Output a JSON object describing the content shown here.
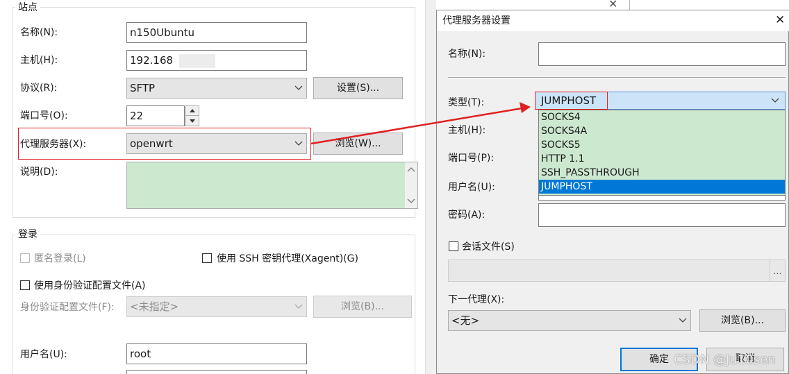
{
  "left_dialog": {
    "site_group_title": "站点",
    "name_label": "名称(N):",
    "name_value": "n150Ubuntu",
    "host_label": "主机(H):",
    "host_value": "192.168",
    "protocol_label": "协议(R):",
    "protocol_value": "SFTP",
    "settings_button": "设置(S)...",
    "port_label": "端口号(O):",
    "port_value": "22",
    "proxy_label": "代理服务器(X):",
    "proxy_value": "openwrt",
    "browse_button": "浏览(W)...",
    "description_label": "说明(D):",
    "login_group_title": "登录",
    "anonymous_login": "匿名登录(L)",
    "ssh_agent": "使用 SSH 密钥代理(Xagent)(G)",
    "use_auth_profile": "使用身份验证配置文件(A)",
    "auth_profile_label": "身份验证配置文件(F):",
    "auth_profile_value": "<未指定>",
    "auth_browse_button": "浏览(B)...",
    "username_label": "用户名(U):",
    "username_value": "root"
  },
  "proxy_dialog": {
    "title": "代理服务器设置",
    "close_glyph": "✕",
    "name_label": "名称(N):",
    "name_value": "",
    "type_label": "类型(T):",
    "type_value": "JUMPHOST",
    "host_label": "主机(H):",
    "port_label": "端口号(P):",
    "username_label": "用户名(U):",
    "password_label": "密码(A):",
    "session_file_label": "会话文件(S)",
    "ellipsis": "...",
    "next_proxy_label": "下一代理(X):",
    "next_proxy_value": "<无>",
    "browse_button": "浏览(B)...",
    "ok_button": "确定",
    "cancel_button": "取消",
    "type_options": [
      "SOCKS4",
      "SOCKS4A",
      "SOCKS5",
      "HTTP 1.1",
      "SSH_PASSTHROUGH",
      "JUMPHOST"
    ],
    "selected_option": "JUMPHOST"
  },
  "watermark": "CSDN @Ju10sen",
  "colors": {
    "annotation_red": "#e02020",
    "selection_blue": "#0078d7",
    "green_bg": "#cce8cf"
  }
}
